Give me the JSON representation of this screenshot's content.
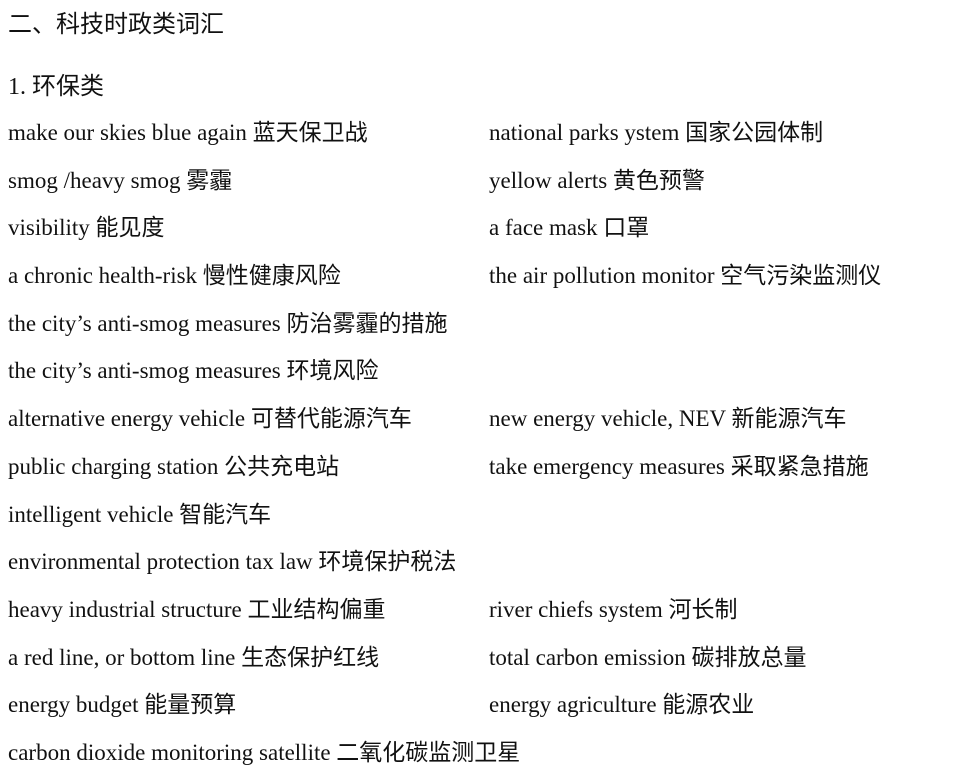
{
  "heading": {
    "section": "二、科技时政类词汇",
    "subsection": "1. 环保类"
  },
  "rows": [
    [
      "make our skies blue again 蓝天保卫战",
      "national parks ystem 国家公园体制"
    ],
    [
      "smog /heavy smog 雾霾",
      "yellow alerts  黄色预警"
    ],
    [
      "visibility 能见度",
      "a face mask 口罩"
    ],
    [
      "a chronic health-risk 慢性健康风险",
      "the air pollution monitor 空气污染监测仪"
    ],
    [
      "the city’s anti-smog measures 防治雾霾的措施",
      ""
    ],
    [
      "the city’s anti-smog measures 环境风险",
      ""
    ],
    [
      "alternative energy vehicle 可替代能源汽车",
      "new energy vehicle,  NEV 新能源汽车"
    ],
    [
      "public charging station 公共充电站",
      "take emergency measures 采取紧急措施"
    ],
    [
      "intelligent vehicle 智能汽车",
      ""
    ],
    [
      "environmental protection tax law 环境保护税法",
      ""
    ],
    [
      "heavy industrial structure 工业结构偏重",
      "river chiefs system 河长制"
    ],
    [
      "a red line, or bottom line 生态保护红线",
      "total carbon emission 碳排放总量"
    ],
    [
      "energy budget 能量预算",
      "energy agriculture 能源农业"
    ],
    [
      "carbon dioxide monitoring satellite 二氧化碳监测卫星",
      ""
    ]
  ]
}
